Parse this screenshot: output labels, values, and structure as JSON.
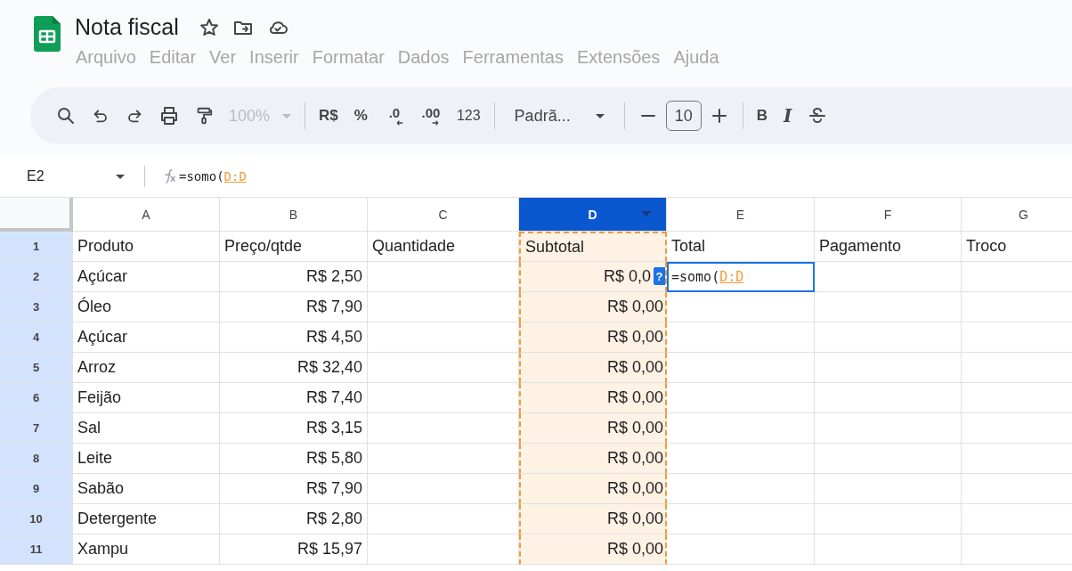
{
  "document": {
    "title": "Nota fiscal"
  },
  "menu": [
    "Arquivo",
    "Editar",
    "Ver",
    "Inserir",
    "Formatar",
    "Dados",
    "Ferramentas",
    "Extensões",
    "Ajuda"
  ],
  "toolbar": {
    "zoom": "100%",
    "zoom_disabled": true,
    "currency": "R$",
    "percent": "%",
    "decrease_decimal": ".0",
    "increase_decimal": ".00",
    "more_formats": "123",
    "font": "Padrã...",
    "font_size": "10",
    "bold": "B",
    "italic": "I"
  },
  "name_box": "E2",
  "formula": [
    {
      "kind": "plain",
      "text": "=somo("
    },
    {
      "kind": "ref",
      "text": "D:D"
    }
  ],
  "columns": [
    {
      "label": "A",
      "selected": false,
      "copied": false
    },
    {
      "label": "B",
      "selected": false,
      "copied": false
    },
    {
      "label": "C",
      "selected": false,
      "copied": false
    },
    {
      "label": "D",
      "selected": true,
      "copied": true
    },
    {
      "label": "E",
      "selected": false,
      "copied": false
    },
    {
      "label": "F",
      "selected": false,
      "copied": false
    },
    {
      "label": "G",
      "selected": false,
      "copied": false
    }
  ],
  "rows": [
    {
      "number": "1",
      "selected": true,
      "cells": [
        "Produto",
        "Preço/qtde",
        "Quantidade",
        "Subtotal",
        "Total",
        "Pagamento",
        "Troco"
      ]
    },
    {
      "number": "2",
      "selected": true,
      "cells": [
        "Açúcar",
        "R$ 2,50",
        null,
        "R$ 0,0",
        {
          "kind": "editor",
          "help_badge": "?",
          "parts": [
            {
              "kind": "plain",
              "text": "=somo("
            },
            {
              "kind": "ref",
              "text": "D:D"
            }
          ]
        },
        null,
        null
      ]
    },
    {
      "number": "3",
      "selected": true,
      "cells": [
        "Óleo",
        "R$ 7,90",
        null,
        "R$ 0,00",
        null,
        null,
        null
      ]
    },
    {
      "number": "4",
      "selected": true,
      "cells": [
        "Açúcar",
        "R$ 4,50",
        null,
        "R$ 0,00",
        null,
        null,
        null
      ]
    },
    {
      "number": "5",
      "selected": true,
      "cells": [
        "Arroz",
        "R$ 32,40",
        null,
        "R$ 0,00",
        null,
        null,
        null
      ]
    },
    {
      "number": "6",
      "selected": true,
      "cells": [
        "Feijão",
        "R$ 7,40",
        null,
        "R$ 0,00",
        null,
        null,
        null
      ]
    },
    {
      "number": "7",
      "selected": true,
      "cells": [
        "Sal",
        "R$ 3,15",
        null,
        "R$ 0,00",
        null,
        null,
        null
      ]
    },
    {
      "number": "8",
      "selected": true,
      "cells": [
        "Leite",
        "R$ 5,80",
        null,
        "R$ 0,00",
        null,
        null,
        null
      ]
    },
    {
      "number": "9",
      "selected": true,
      "cells": [
        "Sabão",
        "R$ 7,90",
        null,
        "R$ 0,00",
        null,
        null,
        null
      ]
    },
    {
      "number": "10",
      "selected": true,
      "cells": [
        "Detergente",
        "R$ 2,80",
        null,
        "R$ 0,00",
        null,
        null,
        null
      ]
    },
    {
      "number": "11",
      "selected": true,
      "cells": [
        "Xampu",
        "R$ 15,97",
        null,
        "R$ 0,00",
        null,
        null,
        null
      ]
    }
  ]
}
